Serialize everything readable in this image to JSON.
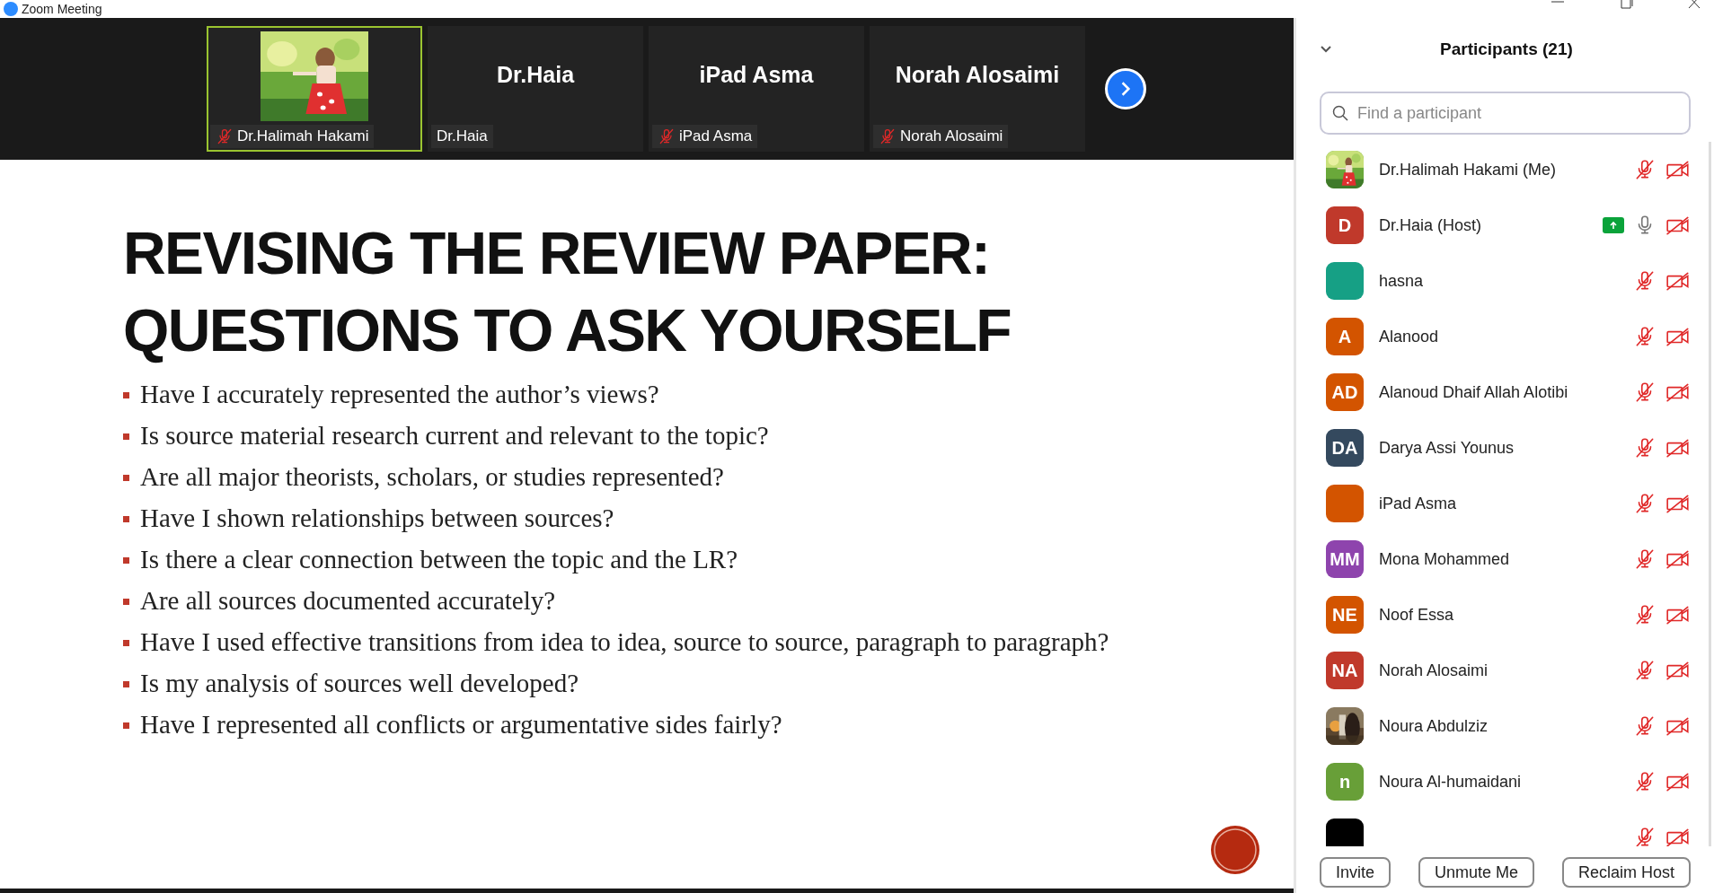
{
  "window": {
    "title": "Zoom Meeting"
  },
  "video_strip": {
    "tiles": [
      {
        "kind": "picture",
        "label": "Dr.Halimah Hakami",
        "muted": true,
        "selected": true
      },
      {
        "kind": "name",
        "name": "Dr.Haia",
        "label": "Dr.Haia",
        "muted": false,
        "selected": false
      },
      {
        "kind": "name",
        "name": "iPad Asma",
        "label": "iPad Asma",
        "muted": true,
        "selected": false
      },
      {
        "kind": "name",
        "name": "Norah Alosaimi",
        "label": "Norah Alosaimi",
        "muted": true,
        "selected": false
      }
    ]
  },
  "slide": {
    "title": "REVISING THE REVIEW PAPER: QUESTIONS TO ASK YOURSELF",
    "bullets": [
      "Have I accurately represented the author’s views?",
      "Is source material research current and relevant to the topic?",
      "Are all major theorists, scholars, or studies represented?",
      "Have I shown relationships between sources?",
      "Is there a clear connection between the topic and the LR?",
      "Are all sources documented accurately?",
      "Have I used effective transitions from idea to idea, source to source, paragraph to paragraph?",
      "Is my analysis of sources well developed?",
      "Have I represented all conflicts or argumentative sides fairly?"
    ]
  },
  "participants_panel": {
    "title": "Participants (21)",
    "search": {
      "placeholder": "Find a participant"
    },
    "participants": [
      {
        "name": "Dr.Halimah Hakami (Me)",
        "kind": "picture",
        "muted": true,
        "video_off": true,
        "sharing": false
      },
      {
        "name": "Dr.Haia (Host)",
        "kind": "initials",
        "initials": "D",
        "color": "#c0392b",
        "muted": false,
        "video_off": true,
        "sharing": true
      },
      {
        "name": "hasna",
        "kind": "blank",
        "color": "#16a085",
        "muted": true,
        "video_off": true,
        "sharing": false
      },
      {
        "name": "Alanood",
        "kind": "initials",
        "initials": "A",
        "color": "#d35400",
        "muted": true,
        "video_off": true,
        "sharing": false
      },
      {
        "name": "Alanoud Dhaif Allah Alotibi",
        "kind": "initials",
        "initials": "AD",
        "color": "#d35400",
        "muted": true,
        "video_off": true,
        "sharing": false
      },
      {
        "name": "Darya Assi Younus",
        "kind": "initials",
        "initials": "DA",
        "color": "#34495e",
        "muted": true,
        "video_off": true,
        "sharing": false
      },
      {
        "name": "iPad Asma",
        "kind": "blank",
        "color": "#d35400",
        "muted": true,
        "video_off": true,
        "sharing": false
      },
      {
        "name": "Mona Mohammed",
        "kind": "initials",
        "initials": "MM",
        "color": "#8e44ad",
        "muted": true,
        "video_off": true,
        "sharing": false
      },
      {
        "name": "Noof Essa",
        "kind": "initials",
        "initials": "NE",
        "color": "#d35400",
        "muted": true,
        "video_off": true,
        "sharing": false
      },
      {
        "name": "Norah Alosaimi",
        "kind": "initials",
        "initials": "NA",
        "color": "#c0392b",
        "muted": true,
        "video_off": true,
        "sharing": false
      },
      {
        "name": "Noura Abdulziz",
        "kind": "picture",
        "muted": true,
        "video_off": true,
        "sharing": false
      },
      {
        "name": "Noura Al-humaidani",
        "kind": "initials",
        "initials": "n",
        "color": "#689f38",
        "muted": true,
        "video_off": true,
        "sharing": false
      },
      {
        "kind": "blank",
        "color": "#000000",
        "muted": true,
        "video_off": true,
        "sharing": false
      }
    ],
    "buttons": [
      "Invite",
      "Unmute Me",
      "Reclaim Host"
    ]
  }
}
